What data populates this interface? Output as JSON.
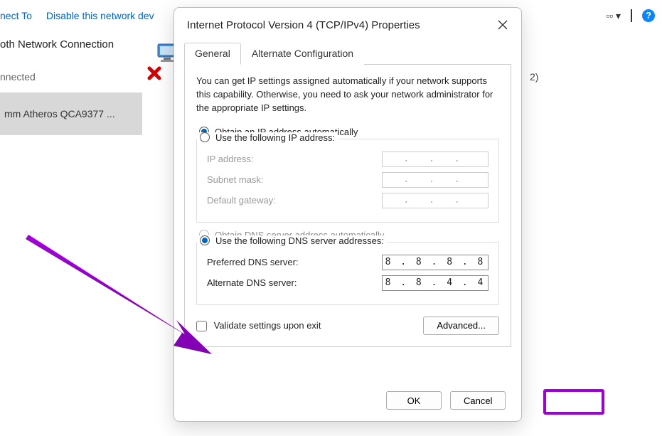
{
  "toolbar": {
    "connect": "nect To",
    "disable": "Disable this network dev",
    "count_suffix": "2)"
  },
  "bg": {
    "connection_name": "oth Network Connection",
    "status": "nnected",
    "adapter": "mm Atheros QCA9377 ..."
  },
  "dialog": {
    "title": "Internet Protocol Version 4 (TCP/IPv4) Properties",
    "tabs": {
      "general": "General",
      "alt": "Alternate Configuration"
    },
    "intro": "You can get IP settings assigned automatically if your network supports this capability. Otherwise, you need to ask your network administrator for the appropriate IP settings.",
    "ip": {
      "auto": "Obtain an IP address automatically",
      "manual": "Use the following IP address:",
      "addr_label": "IP address:",
      "mask_label": "Subnet mask:",
      "gw_label": "Default gateway:",
      "dots": ".     .     ."
    },
    "dns": {
      "auto": "Obtain DNS server address automatically",
      "manual": "Use the following DNS server addresses:",
      "pref_label": "Preferred DNS server:",
      "alt_label": "Alternate DNS server:",
      "pref_value": "8 . 8 . 8 . 8",
      "alt_value": "8 . 8 . 4 . 4"
    },
    "validate": "Validate settings upon exit",
    "advanced": "Advanced...",
    "ok": "OK",
    "cancel": "Cancel"
  }
}
